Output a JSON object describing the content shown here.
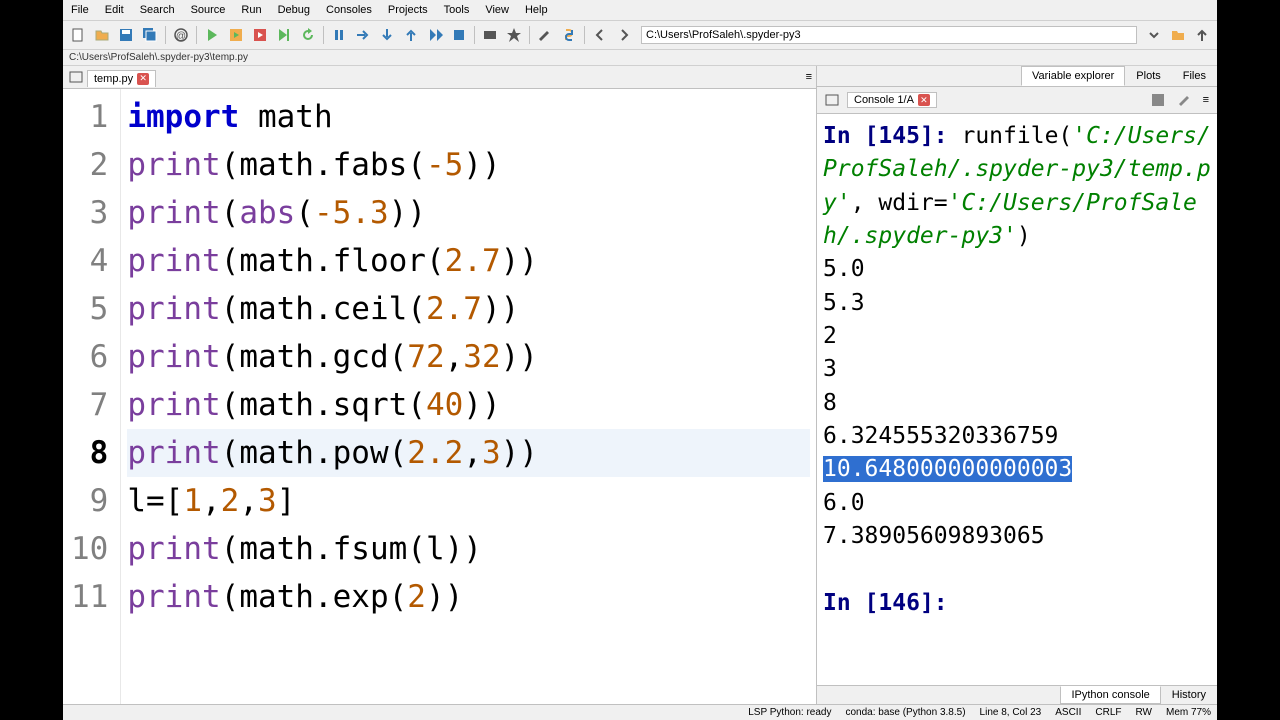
{
  "menu": [
    "File",
    "Edit",
    "Search",
    "Source",
    "Run",
    "Debug",
    "Consoles",
    "Projects",
    "Tools",
    "View",
    "Help"
  ],
  "cwd": "C:\\Users\\ProfSaleh\\.spyder-py3",
  "pathbar": "C:\\Users\\ProfSaleh\\.spyder-py3\\temp.py",
  "tab": {
    "name": "temp.py"
  },
  "code": {
    "current_line": 8,
    "lines": [
      [
        {
          "t": "import ",
          "c": "kw"
        },
        {
          "t": "math",
          "c": "id"
        }
      ],
      [
        {
          "t": "print",
          "c": "fn"
        },
        {
          "t": "(math.fabs(",
          "c": "id"
        },
        {
          "t": "-5",
          "c": "num"
        },
        {
          "t": "))",
          "c": "id"
        }
      ],
      [
        {
          "t": "print",
          "c": "fn"
        },
        {
          "t": "(",
          "c": "id"
        },
        {
          "t": "abs",
          "c": "fn"
        },
        {
          "t": "(",
          "c": "id"
        },
        {
          "t": "-5.3",
          "c": "num"
        },
        {
          "t": "))",
          "c": "id"
        }
      ],
      [
        {
          "t": "print",
          "c": "fn"
        },
        {
          "t": "(math.floor(",
          "c": "id"
        },
        {
          "t": "2.7",
          "c": "num"
        },
        {
          "t": "))",
          "c": "id"
        }
      ],
      [
        {
          "t": "print",
          "c": "fn"
        },
        {
          "t": "(math.ceil(",
          "c": "id"
        },
        {
          "t": "2.7",
          "c": "num"
        },
        {
          "t": "))",
          "c": "id"
        }
      ],
      [
        {
          "t": "print",
          "c": "fn"
        },
        {
          "t": "(math.gcd(",
          "c": "id"
        },
        {
          "t": "72",
          "c": "num"
        },
        {
          "t": ",",
          "c": "id"
        },
        {
          "t": "32",
          "c": "num"
        },
        {
          "t": "))",
          "c": "id"
        }
      ],
      [
        {
          "t": "print",
          "c": "fn"
        },
        {
          "t": "(math.sqrt(",
          "c": "id"
        },
        {
          "t": "40",
          "c": "num"
        },
        {
          "t": "))",
          "c": "id"
        }
      ],
      [
        {
          "t": "print",
          "c": "fn"
        },
        {
          "t": "(math.pow(",
          "c": "id"
        },
        {
          "t": "2.2",
          "c": "num"
        },
        {
          "t": ",",
          "c": "id"
        },
        {
          "t": "3",
          "c": "num"
        },
        {
          "t": "))",
          "c": "id"
        }
      ],
      [
        {
          "t": "l=[",
          "c": "id"
        },
        {
          "t": "1",
          "c": "num"
        },
        {
          "t": ",",
          "c": "id"
        },
        {
          "t": "2",
          "c": "num"
        },
        {
          "t": ",",
          "c": "id"
        },
        {
          "t": "3",
          "c": "num"
        },
        {
          "t": "]",
          "c": "id"
        }
      ],
      [
        {
          "t": "print",
          "c": "fn"
        },
        {
          "t": "(math.fsum(l))",
          "c": "id"
        }
      ],
      [
        {
          "t": "print",
          "c": "fn"
        },
        {
          "t": "(math.exp(",
          "c": "id"
        },
        {
          "t": "2",
          "c": "num"
        },
        {
          "t": "))",
          "c": "id"
        }
      ]
    ]
  },
  "right_tabs": [
    "Variable explorer",
    "Plots",
    "Files"
  ],
  "right_active": 0,
  "console_tab": "Console 1/A",
  "console": {
    "in_label": "In ",
    "prompt1_num": "145",
    "runfile": "runfile",
    "path1": "'C:/Users/ProfSaleh/.spyder-py3/temp.py'",
    "wdir_label": ", wdir=",
    "path2": "'C:/Users/ProfSaleh/.spyder-py3'",
    "close_paren": ")",
    "outputs": [
      "5.0",
      "5.3",
      "2",
      "3",
      "8",
      "6.324555320336759",
      "10.648000000000003",
      "6.0",
      "7.38905609893065"
    ],
    "selected_output_index": 6,
    "prompt2_num": "146",
    "prompt_suffix": ": "
  },
  "bottom_tabs": [
    "IPython console",
    "History"
  ],
  "bottom_active": 0,
  "status": {
    "lsp": "LSP Python: ready",
    "conda": "conda: base (Python 3.8.5)",
    "pos": "Line 8, Col 23",
    "enc": "ASCII",
    "eol": "CRLF",
    "rw": "RW",
    "mem": "Mem 77%"
  }
}
